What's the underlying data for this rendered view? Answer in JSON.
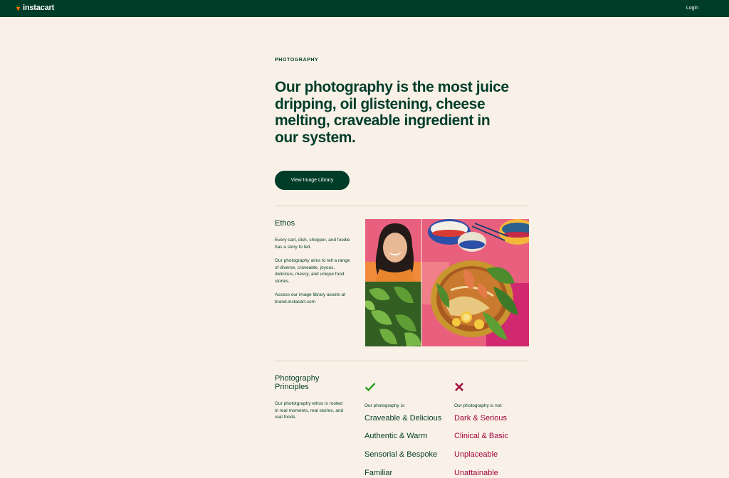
{
  "header": {
    "brand": "instacart",
    "login_label": "Login"
  },
  "hero": {
    "eyebrow": "PHOTOGRAPHY",
    "headline": "Our photography is the most juice dripping, oil glistening, cheese melting, craveable ingredient in our system.",
    "cta_label": "View Image Library"
  },
  "ethos": {
    "title": "Ethos",
    "para1": "Every cart, dish, shopper, and foodie has a story to tell.",
    "para2": "Our photography aims to tell a range of diverse, craveable, joyous, delicious, messy, and unique food stories.",
    "para3": "Access our image library assets at brand.instacart.com"
  },
  "principles": {
    "title": "Photography Principles",
    "description": "Our phototgraphy ethos is rooted in real moments, real stories, and real foods.",
    "is_label": "Our photography is:",
    "is_not_label": "Our photography is not:",
    "is_items": [
      "Craveable & Delicious",
      "Authentic & Warm",
      "Sensorial & Bespoke",
      "Familiar"
    ],
    "is_not_items": [
      "Dark & Serious",
      "Clinical & Basic",
      "Unplaceable",
      "Unattainable"
    ]
  },
  "colors": {
    "brand_green": "#003d29",
    "background": "#f9f1e7",
    "positive": "#2a9d1e",
    "negative": "#a0003c",
    "logo_carrot": "#ff7009"
  }
}
